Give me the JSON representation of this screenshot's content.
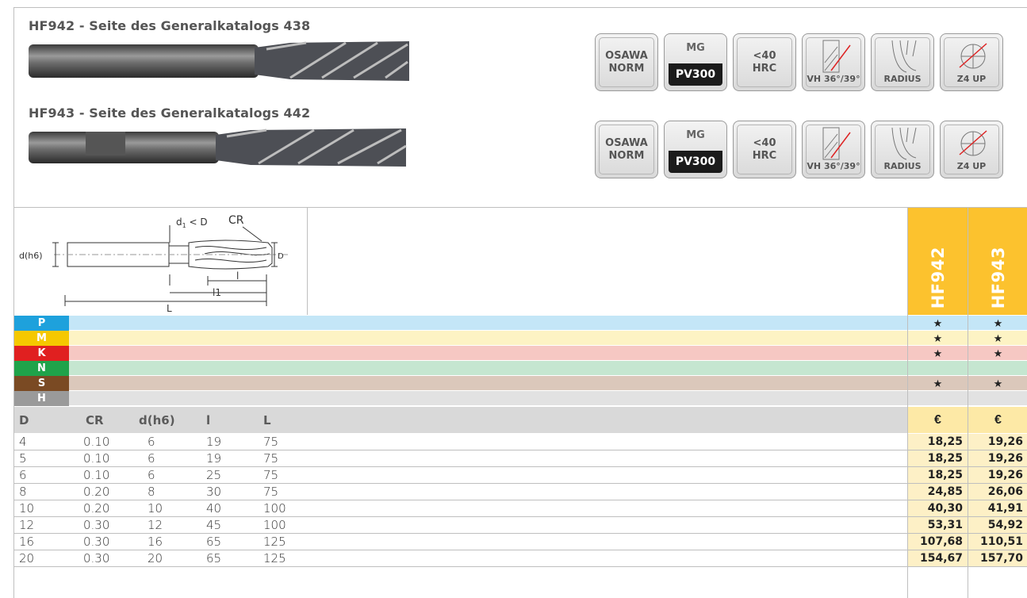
{
  "products": [
    {
      "title": "HF942 - Seite des Generalkatalogs 438"
    },
    {
      "title": "HF943 - Seite des Generalkatalogs 442"
    }
  ],
  "badges": {
    "osawa": [
      "OSAWA",
      "NORM"
    ],
    "mg": "MG",
    "pv": "PV300",
    "hrc": [
      "<40",
      "HRC"
    ],
    "vh": "VH 36°/39°",
    "radius": "RADIUS",
    "z4": "Z4 UP"
  },
  "diagram": {
    "d1": "d",
    "d1_sub": "1",
    "d1_rest": " < D",
    "cr": "CR",
    "dh6": "d(h6)",
    "D": "D",
    "l": "l",
    "l1": "l1",
    "L": "L"
  },
  "columns": [
    "HF942",
    "HF943"
  ],
  "materials": [
    {
      "tag": "P",
      "color": "#1ea1dc",
      "bg": "#c4e6f7",
      "stars": [
        "★",
        "★"
      ]
    },
    {
      "tag": "M",
      "color": "#f5c800",
      "bg": "#fdf3c4",
      "stars": [
        "★",
        "★"
      ]
    },
    {
      "tag": "K",
      "color": "#e02020",
      "bg": "#f6c8c3",
      "stars": [
        "★",
        "★"
      ]
    },
    {
      "tag": "N",
      "color": "#1fa34a",
      "bg": "#c5e6d0",
      "stars": [
        "",
        ""
      ]
    },
    {
      "tag": "S",
      "color": "#7a4a23",
      "bg": "#dbc8bb",
      "stars": [
        "★",
        "★"
      ]
    },
    {
      "tag": "H",
      "color": "#9a9a9a",
      "bg": "#e2e2e2",
      "stars": [
        "",
        ""
      ]
    }
  ],
  "headers": [
    "D",
    "CR",
    "d(h6)",
    "l",
    "L"
  ],
  "currency": "€",
  "rows": [
    {
      "D": "4",
      "CR": "0.10",
      "d": "6",
      "l": "19",
      "L": "75",
      "p1": "18,25",
      "p2": "19,26"
    },
    {
      "D": "5",
      "CR": "0.10",
      "d": "6",
      "l": "19",
      "L": "75",
      "p1": "18,25",
      "p2": "19,26"
    },
    {
      "D": "6",
      "CR": "0.10",
      "d": "6",
      "l": "25",
      "L": "75",
      "p1": "18,25",
      "p2": "19,26"
    },
    {
      "D": "8",
      "CR": "0.20",
      "d": "8",
      "l": "30",
      "L": "75",
      "p1": "24,85",
      "p2": "26,06"
    },
    {
      "D": "10",
      "CR": "0.20",
      "d": "10",
      "l": "40",
      "L": "100",
      "p1": "40,30",
      "p2": "41,91"
    },
    {
      "D": "12",
      "CR": "0.30",
      "d": "12",
      "l": "45",
      "L": "100",
      "p1": "53,31",
      "p2": "54,92"
    },
    {
      "D": "16",
      "CR": "0.30",
      "d": "16",
      "l": "65",
      "L": "125",
      "p1": "107,68",
      "p2": "110,51"
    },
    {
      "D": "20",
      "CR": "0.30",
      "d": "20",
      "l": "65",
      "L": "125",
      "p1": "154,67",
      "p2": "157,70"
    }
  ]
}
